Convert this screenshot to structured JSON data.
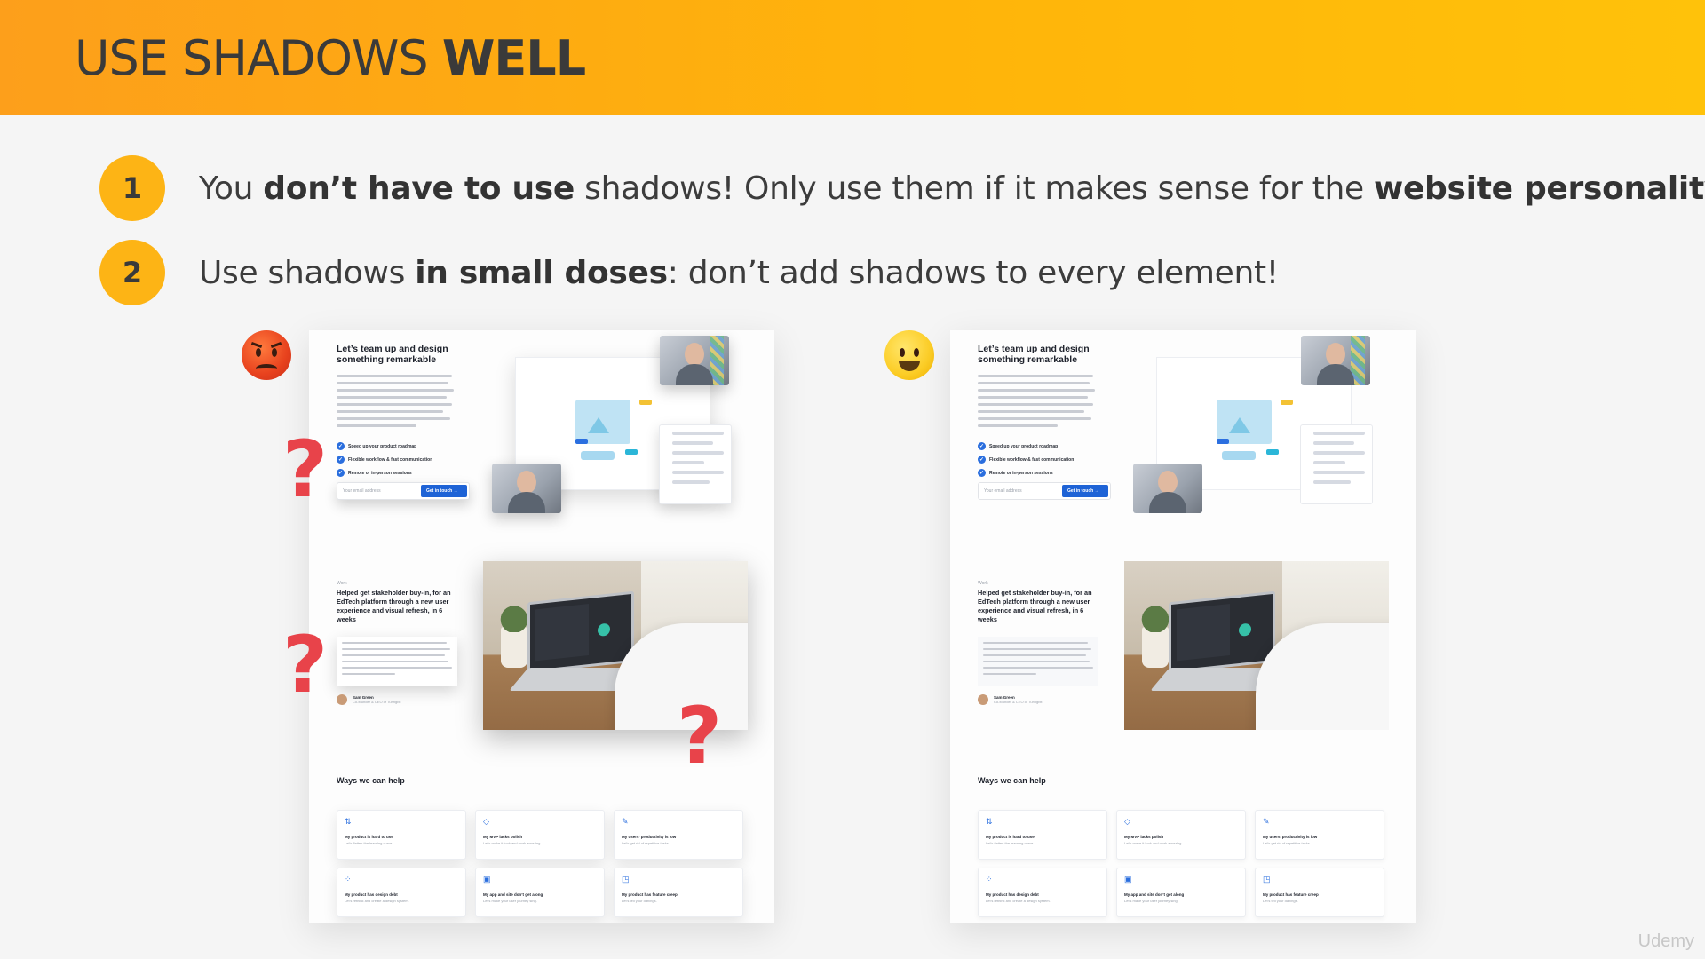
{
  "header": {
    "title_regular": "USE SHADOWS",
    "title_bold": "WELL",
    "accent": "#fdb415"
  },
  "points": [
    {
      "number": "1",
      "t1": "You ",
      "b1": "don’t have to use",
      "t2": " shadows! Only use them if it makes sense for the ",
      "b2": "website personality"
    },
    {
      "number": "2",
      "t1": "Use shadows ",
      "b1": "in small doses",
      "t2": ": don’t add shadows to every element!"
    }
  ],
  "emoji": {
    "bad": "angry-face-icon",
    "good": "smiling-face-icon"
  },
  "question_mark": "?",
  "mockup": {
    "hero_title": "Let’s team up and design something remarkable",
    "checks": [
      "Speed up your product roadmap",
      "Flexible workflow & fast communication",
      "Remote or in-person sessions"
    ],
    "email_placeholder": "Your email address",
    "cta": "Get in touch →",
    "work_label": "Work",
    "work_title": "Helped get stakeholder buy-in, for an EdTech platform through a new user experience and visual refresh, in 6 weeks",
    "person_name": "Sam Green",
    "person_role": "Co-founder & CEO of Turingbit",
    "ways_title": "Ways we can help",
    "cards": [
      {
        "title": "My product is hard to use",
        "sub": "Let’s flatten the learning curve.",
        "icon": "⇅"
      },
      {
        "title": "My MVP lacks polish",
        "sub": "Let’s make it look and work amazing.",
        "icon": "◇"
      },
      {
        "title": "My users’ productivity is low",
        "sub": "Let’s get rid of repetitive tasks.",
        "icon": "✎"
      },
      {
        "title": "My product has design debt",
        "sub": "Let’s rethink and create a design system.",
        "icon": "⁘"
      },
      {
        "title": "My app and site don’t get along",
        "sub": "Let’s make your user journey sing.",
        "icon": "▣"
      },
      {
        "title": "My product has feature creep",
        "sub": "Let’s tell your darlings.",
        "icon": "◳"
      }
    ]
  },
  "brand": "Udemy"
}
